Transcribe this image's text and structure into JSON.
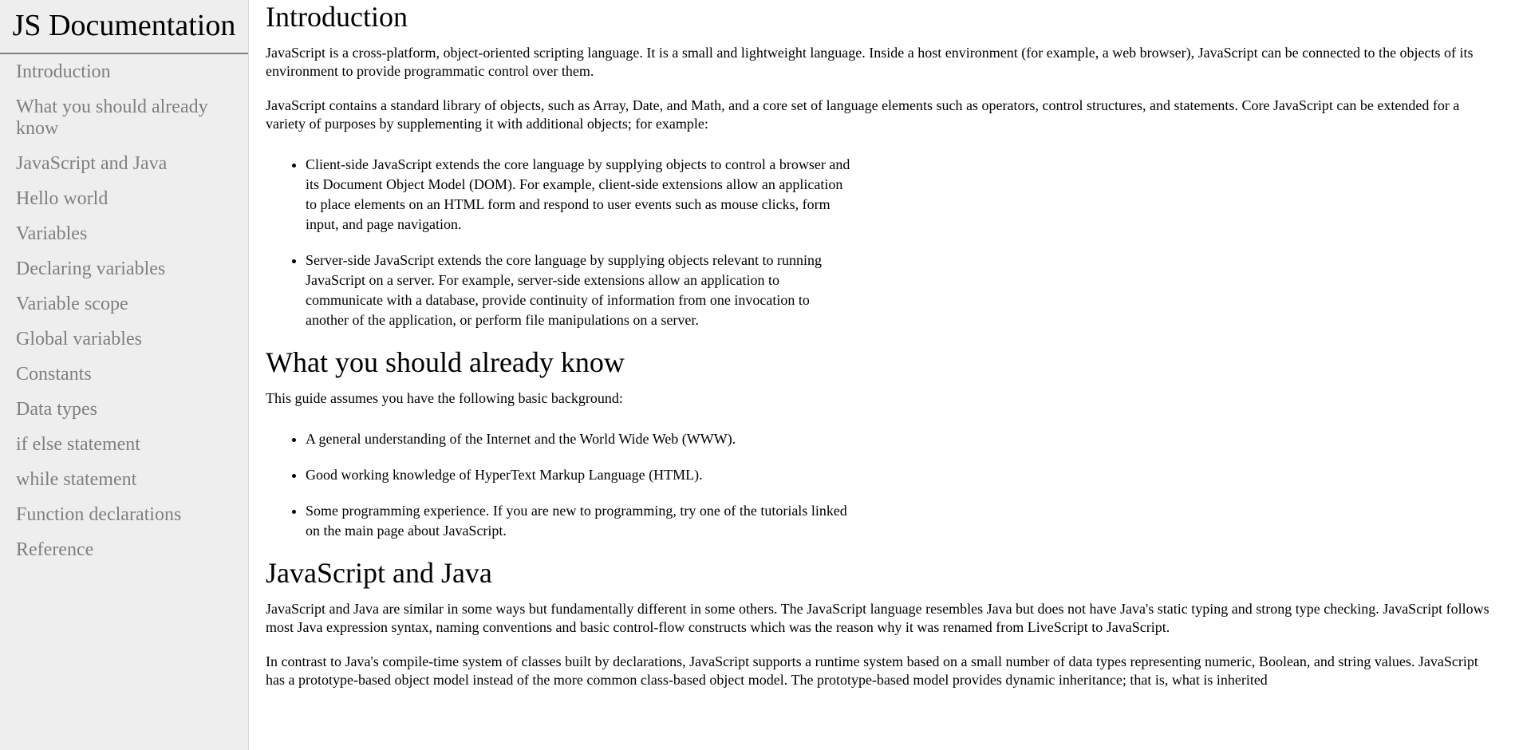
{
  "navbar": {
    "title": "JS Documentation",
    "links": [
      "Introduction",
      "What you should already know",
      "JavaScript and Java",
      "Hello world",
      "Variables",
      "Declaring variables",
      "Variable scope",
      "Global variables",
      "Constants",
      "Data types",
      "if else statement",
      "while statement",
      "Function declarations",
      "Reference"
    ]
  },
  "sections": {
    "introduction": {
      "title": "Introduction",
      "paragraphs": [
        "JavaScript is a cross-platform, object-oriented scripting language. It is a small and lightweight language. Inside a host environment (for example, a web browser), JavaScript can be connected to the objects of its environment to provide programmatic control over them.",
        "JavaScript contains a standard library of objects, such as Array, Date, and Math, and a core set of language elements such as operators, control structures, and statements. Core JavaScript can be extended for a variety of purposes by supplementing it with additional objects; for example:"
      ],
      "list": [
        "Client-side JavaScript extends the core language by supplying objects to control a browser and its Document Object Model (DOM). For example, client-side extensions allow an application to place elements on an HTML form and respond to user events such as mouse clicks, form input, and page navigation.",
        "Server-side JavaScript extends the core language by supplying objects relevant to running JavaScript on a server. For example, server-side extensions allow an application to communicate with a database, provide continuity of information from one invocation to another of the application, or perform file manipulations on a server."
      ]
    },
    "what_you_should_know": {
      "title": "What you should already know",
      "paragraphs": [
        "This guide assumes you have the following basic background:"
      ],
      "list": [
        "A general understanding of the Internet and the World Wide Web (WWW).",
        "Good working knowledge of HyperText Markup Language (HTML).",
        "Some programming experience. If you are new to programming, try one of the tutorials linked on the main page about JavaScript."
      ]
    },
    "javascript_and_java": {
      "title": "JavaScript and Java",
      "paragraphs": [
        "JavaScript and Java are similar in some ways but fundamentally different in some others. The JavaScript language resembles Java but does not have Java's static typing and strong type checking. JavaScript follows most Java expression syntax, naming conventions and basic control-flow constructs which was the reason why it was renamed from LiveScript to JavaScript.",
        "In contrast to Java's compile-time system of classes built by declarations, JavaScript supports a runtime system based on a small number of data types representing numeric, Boolean, and string values. JavaScript has a prototype-based object model instead of the more common class-based object model. The prototype-based model provides dynamic inheritance; that is, what is inherited"
      ]
    }
  }
}
